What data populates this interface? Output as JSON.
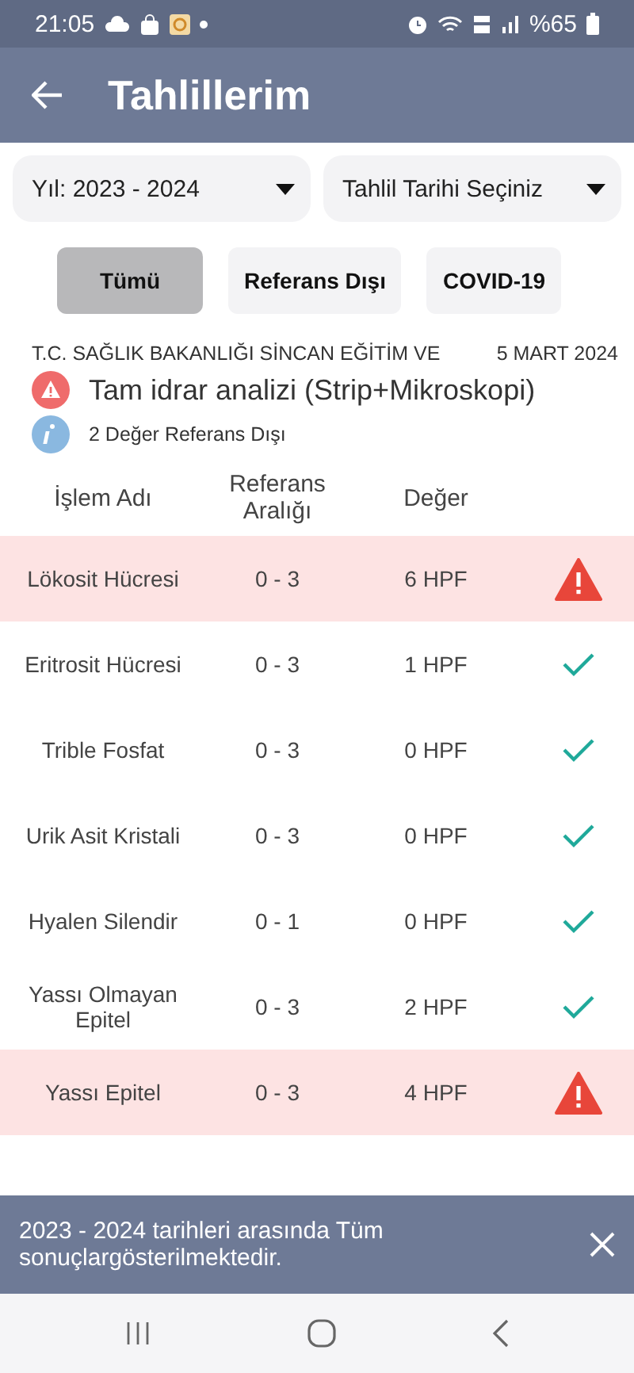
{
  "status_bar": {
    "time": "21:05",
    "battery": "%65"
  },
  "app_bar": {
    "title": "Tahlillerim"
  },
  "selects": [
    {
      "value": "Yıl: 2023 - 2024"
    },
    {
      "value": "Tahlil Tarihi Seçiniz"
    }
  ],
  "filters": [
    {
      "label": "Tümü",
      "selected": true
    },
    {
      "label": "Referans Dışı",
      "selected": false
    },
    {
      "label": "COVID-19",
      "selected": false
    }
  ],
  "result": {
    "institution": "T.C. SAĞLIK BAKANLIĞI SİNCAN EĞİTİM VE",
    "date": "5 MART 2024",
    "test_name": "Tam idrar analizi (Strip+Mikroskopi)",
    "summary": "2 Değer Referans Dışı"
  },
  "table": {
    "columns": [
      "İşlem Adı",
      "Referans Aralığı",
      "Değer"
    ],
    "rows": [
      {
        "name": "Lökosit Hücresi",
        "range": "0 - 3",
        "value": "6 HPF",
        "out_of_range": true
      },
      {
        "name": "Eritrosit Hücresi",
        "range": "0 - 3",
        "value": "1 HPF",
        "out_of_range": false
      },
      {
        "name": "Trible Fosfat",
        "range": "0 - 3",
        "value": "0 HPF",
        "out_of_range": false
      },
      {
        "name": "Urik Asit Kristali",
        "range": "0 - 3",
        "value": "0 HPF",
        "out_of_range": false
      },
      {
        "name": "Hyalen Silendir",
        "range": "0 - 1",
        "value": "0 HPF",
        "out_of_range": false
      },
      {
        "name": "Yassı Olmayan Epitel",
        "range": "0 - 3",
        "value": "2 HPF",
        "out_of_range": false
      },
      {
        "name": "Yassı Epitel",
        "range": "0 - 3",
        "value": "4 HPF",
        "out_of_range": true
      }
    ]
  },
  "snackbar": {
    "message": "2023 - 2024 tarihleri arasında Tüm sonuçlargösterilmektedir."
  }
}
